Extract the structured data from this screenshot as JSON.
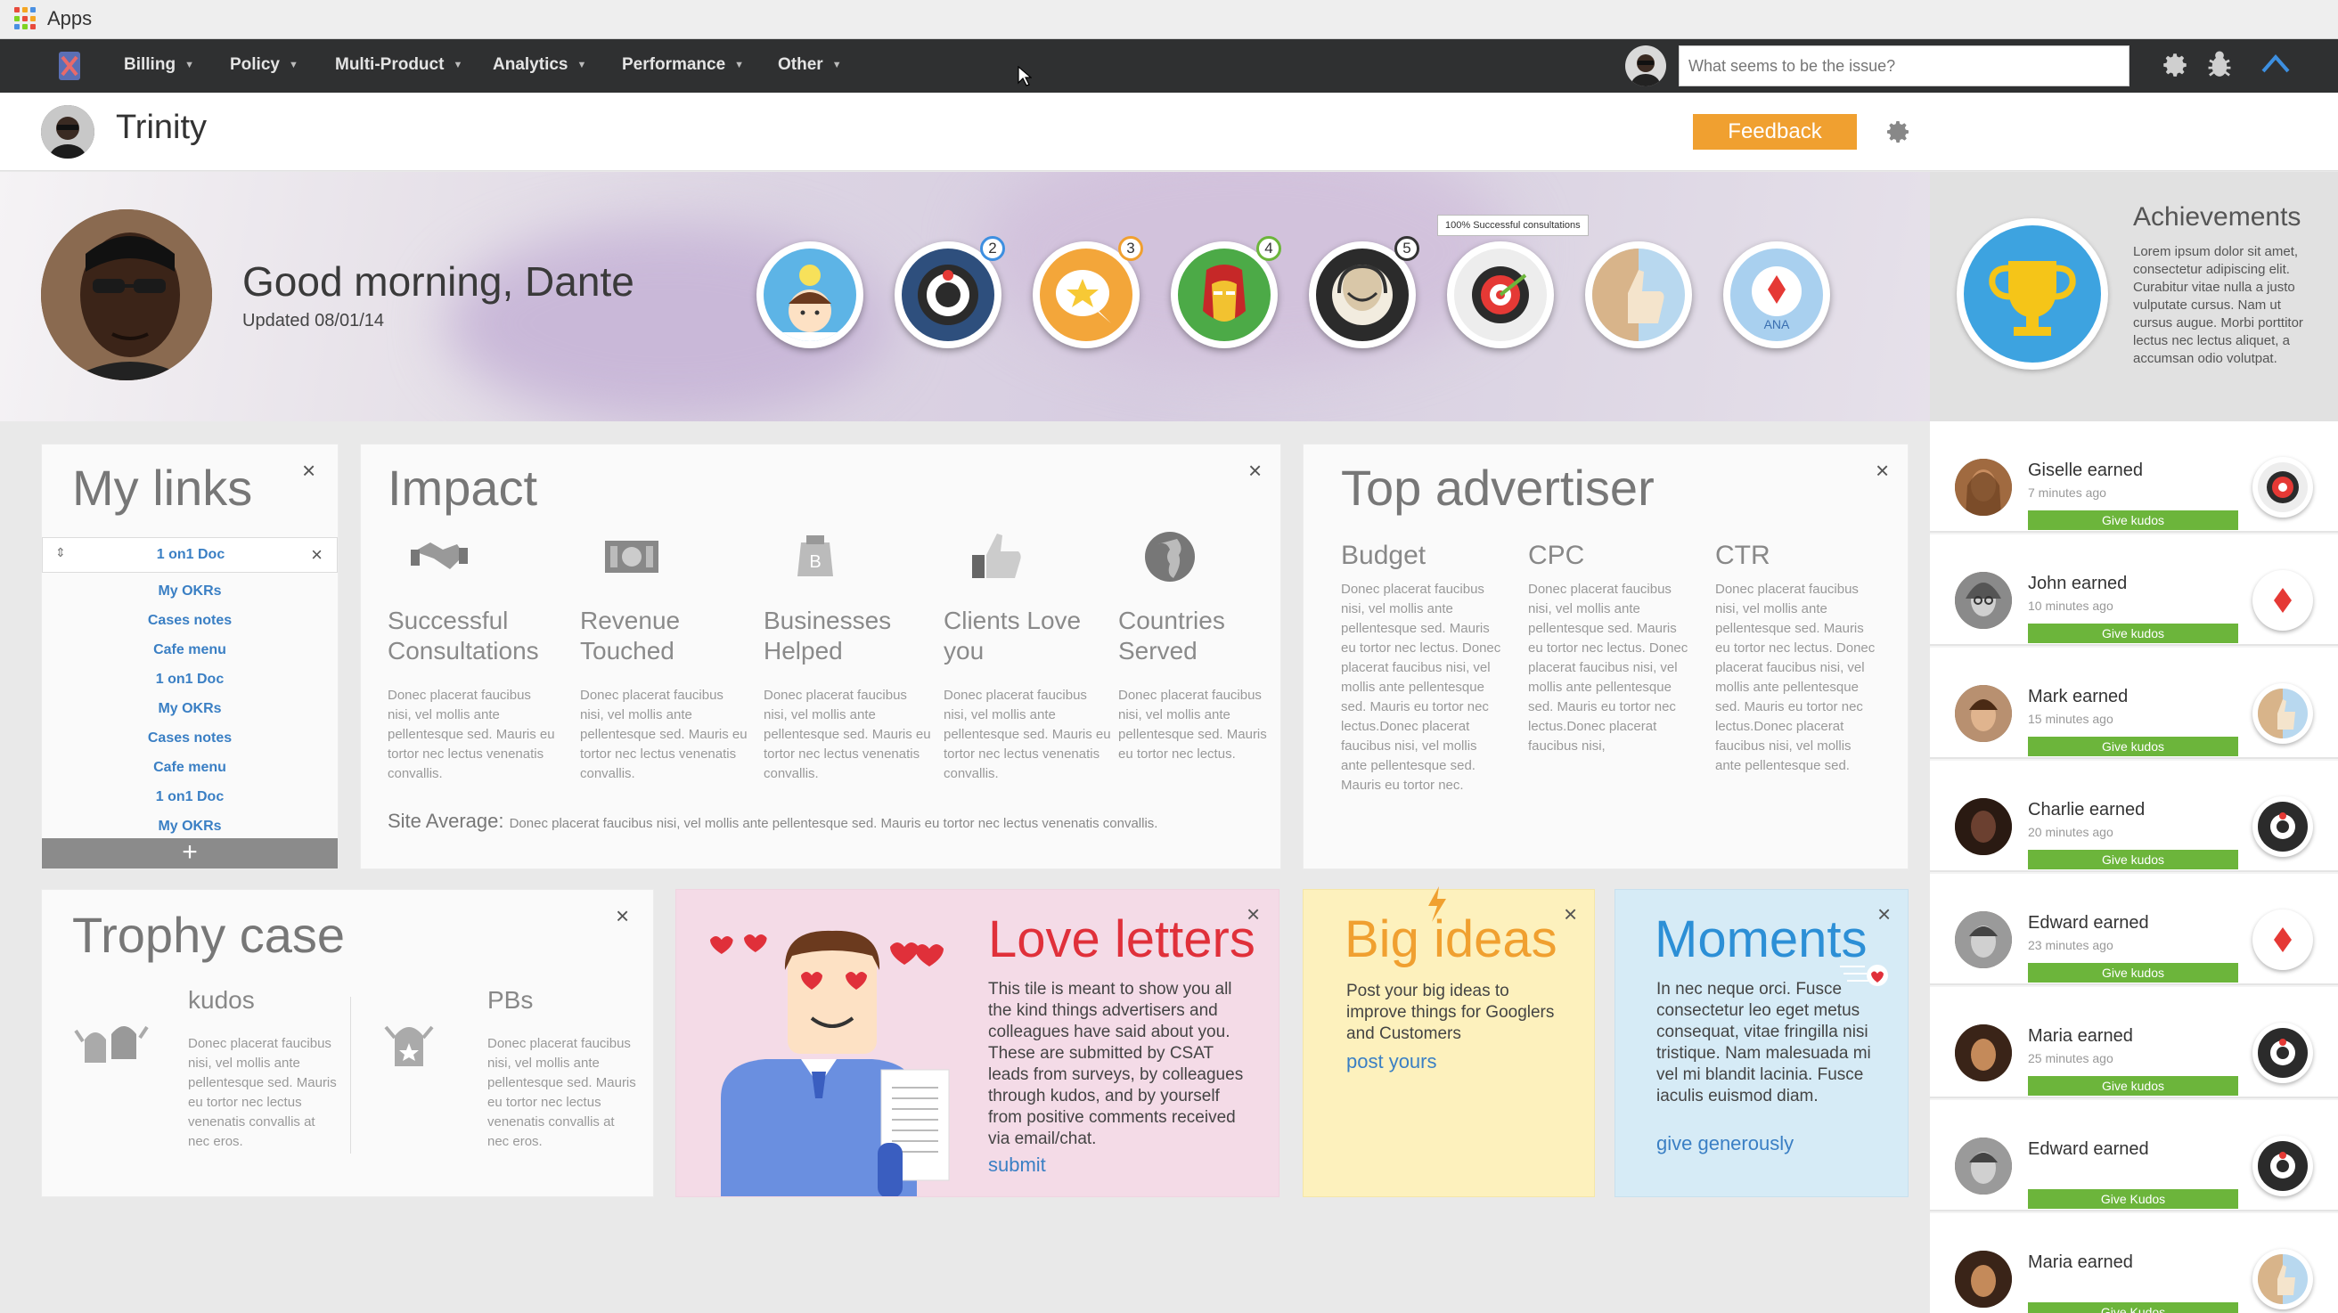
{
  "topbar": {
    "apps_label": "Apps"
  },
  "nav": {
    "items": [
      "Billing",
      "Policy",
      "Multi-Product",
      "Analytics",
      "Performance",
      "Other"
    ],
    "search_placeholder": "What seems to be the issue?"
  },
  "header": {
    "name": "Trinity",
    "feedback_label": "Feedback"
  },
  "hero": {
    "greeting": "Good morning, Dante",
    "updated": "Updated 08/01/14",
    "badges": [
      {
        "icon": "bulb-person-badge-icon",
        "count": ""
      },
      {
        "icon": "gear-target-badge-icon",
        "count": "2"
      },
      {
        "icon": "star-chat-badge-icon",
        "count": "3"
      },
      {
        "icon": "ironman-badge-icon",
        "count": "4"
      },
      {
        "icon": "headset-agent-badge-icon",
        "count": "5"
      },
      {
        "icon": "target-dart-badge-icon",
        "count": ""
      },
      {
        "icon": "thumbs-up-badge-icon",
        "count": ""
      },
      {
        "icon": "ana-badge-icon",
        "count": ""
      }
    ],
    "tooltip": "100% Successful consultations"
  },
  "achievements": {
    "title": "Achievements",
    "text": "Lorem ipsum dolor sit amet, consectetur adipiscing elit. Curabitur vitae nulla a justo vulputate cursus. Nam ut cursus augue. Morbi porttitor lectus nec lectus aliquet, a accumsan odio volutpat."
  },
  "feed": [
    {
      "name": "Giselle earned",
      "time": "7 minutes ago",
      "button": "Give kudos"
    },
    {
      "name": "John earned",
      "time": "10 minutes ago",
      "button": "Give kudos"
    },
    {
      "name": "Mark earned",
      "time": "15 minutes ago",
      "button": "Give kudos"
    },
    {
      "name": "Charlie earned",
      "time": "20 minutes ago",
      "button": "Give kudos"
    },
    {
      "name": "Edward earned",
      "time": "23 minutes ago",
      "button": "Give kudos"
    },
    {
      "name": "Maria earned",
      "time": "25 minutes ago",
      "button": "Give kudos"
    },
    {
      "name": "Edward earned",
      "time": "",
      "button": "Give Kudos"
    },
    {
      "name": "Maria earned",
      "time": "",
      "button": "Give Kudos"
    }
  ],
  "my_links": {
    "title": "My links",
    "items": [
      "1 on1 Doc",
      "My OKRs",
      "Cases notes",
      "Cafe menu",
      "1 on1 Doc",
      "My OKRs",
      "Cases notes",
      "Cafe menu",
      "1 on1 Doc",
      "My OKRs"
    ],
    "add_label": "+"
  },
  "impact": {
    "title": "Impact",
    "metrics": [
      {
        "label": "Successful Consultations",
        "text": "Donec placerat faucibus nisi, vel mollis ante pellentesque sed. Mauris eu tortor nec lectus venenatis convallis.",
        "icon": "handshake-icon"
      },
      {
        "label": "Revenue Touched",
        "text": "Donec placerat faucibus nisi, vel mollis ante pellentesque sed. Mauris eu tortor nec lectus venenatis convallis.",
        "icon": "money-icon"
      },
      {
        "label": "Businesses Helped",
        "text": "Donec placerat faucibus nisi, vel mollis ante pellentesque sed. Mauris eu tortor nec lectus venenatis convallis.",
        "icon": "business-icon"
      },
      {
        "label": "Clients Love you",
        "text": "Donec placerat faucibus nisi, vel mollis ante pellentesque sed. Mauris eu tortor nec lectus venenatis convallis.",
        "icon": "thumbs-up-icon"
      },
      {
        "label": "Countries Served",
        "text": "Donec placerat faucibus nisi, vel mollis ante pellentesque sed. Mauris eu tortor nec lectus.",
        "icon": "globe-icon"
      }
    ],
    "site_average_label": "Site Average:",
    "site_average_text": "Donec placerat faucibus nisi, vel mollis ante pellentesque sed. Mauris eu tortor nec lectus venenatis convallis."
  },
  "top_advertiser": {
    "title": "Top advertiser",
    "columns": [
      {
        "heading": "Budget",
        "text": "Donec placerat faucibus nisi, vel mollis ante pellentesque sed. Mauris eu tortor nec lectus. Donec placerat faucibus nisi, vel mollis ante pellentesque sed. Mauris eu tortor nec lectus.Donec placerat faucibus nisi, vel mollis ante pellentesque sed. Mauris eu tortor nec."
      },
      {
        "heading": "CPC",
        "text": "Donec placerat faucibus nisi, vel mollis ante pellentesque sed. Mauris eu tortor nec lectus. Donec placerat faucibus nisi, vel mollis ante pellentesque sed. Mauris eu tortor nec lectus.Donec placerat faucibus nisi,"
      },
      {
        "heading": "CTR",
        "text": "Donec placerat faucibus nisi, vel mollis ante pellentesque sed. Mauris eu tortor nec lectus. Donec placerat faucibus nisi, vel mollis ante pellentesque sed. Mauris eu tortor nec lectus.Donec placerat faucibus nisi, vel mollis ante pellentesque sed."
      }
    ]
  },
  "trophy_case": {
    "title": "Trophy case",
    "columns": [
      {
        "label": "kudos",
        "text": "Donec placerat faucibus nisi, vel mollis ante pellentesque sed. Mauris eu tortor nec lectus venenatis convallis at nec eros."
      },
      {
        "label": "PBs",
        "text": "Donec placerat faucibus nisi, vel mollis ante pellentesque sed. Mauris eu tortor nec lectus venenatis convallis at nec eros."
      }
    ]
  },
  "love_letters": {
    "title": "Love letters",
    "text": "This tile is meant to show you all the kind things advertisers and colleagues have said about you. These are submitted by CSAT leads from surveys, by colleagues through kudos, and by yourself from positive comments received via email/chat.",
    "link": "submit"
  },
  "big_ideas": {
    "title": "Big ideas",
    "text": "Post your big ideas to improve things for Googlers and Customers",
    "link": "post yours"
  },
  "moments": {
    "title": "Moments",
    "text": "In nec neque orci. Fusce consectetur leo eget metus consequat, vitae fringilla nisi tristique. Nam malesuada mi vel mi blandit lacinia. Fusce iaculis euismod diam.",
    "link": "give generously"
  },
  "colors": {
    "nav_bg": "#2f3031",
    "feedback": "#f0a030",
    "kudos_green": "#6cb53b",
    "link_blue": "#3a7fc4",
    "love_red": "#e0303a",
    "big_ideas_orange": "#f0a030",
    "moments_blue": "#2c8fd6"
  }
}
